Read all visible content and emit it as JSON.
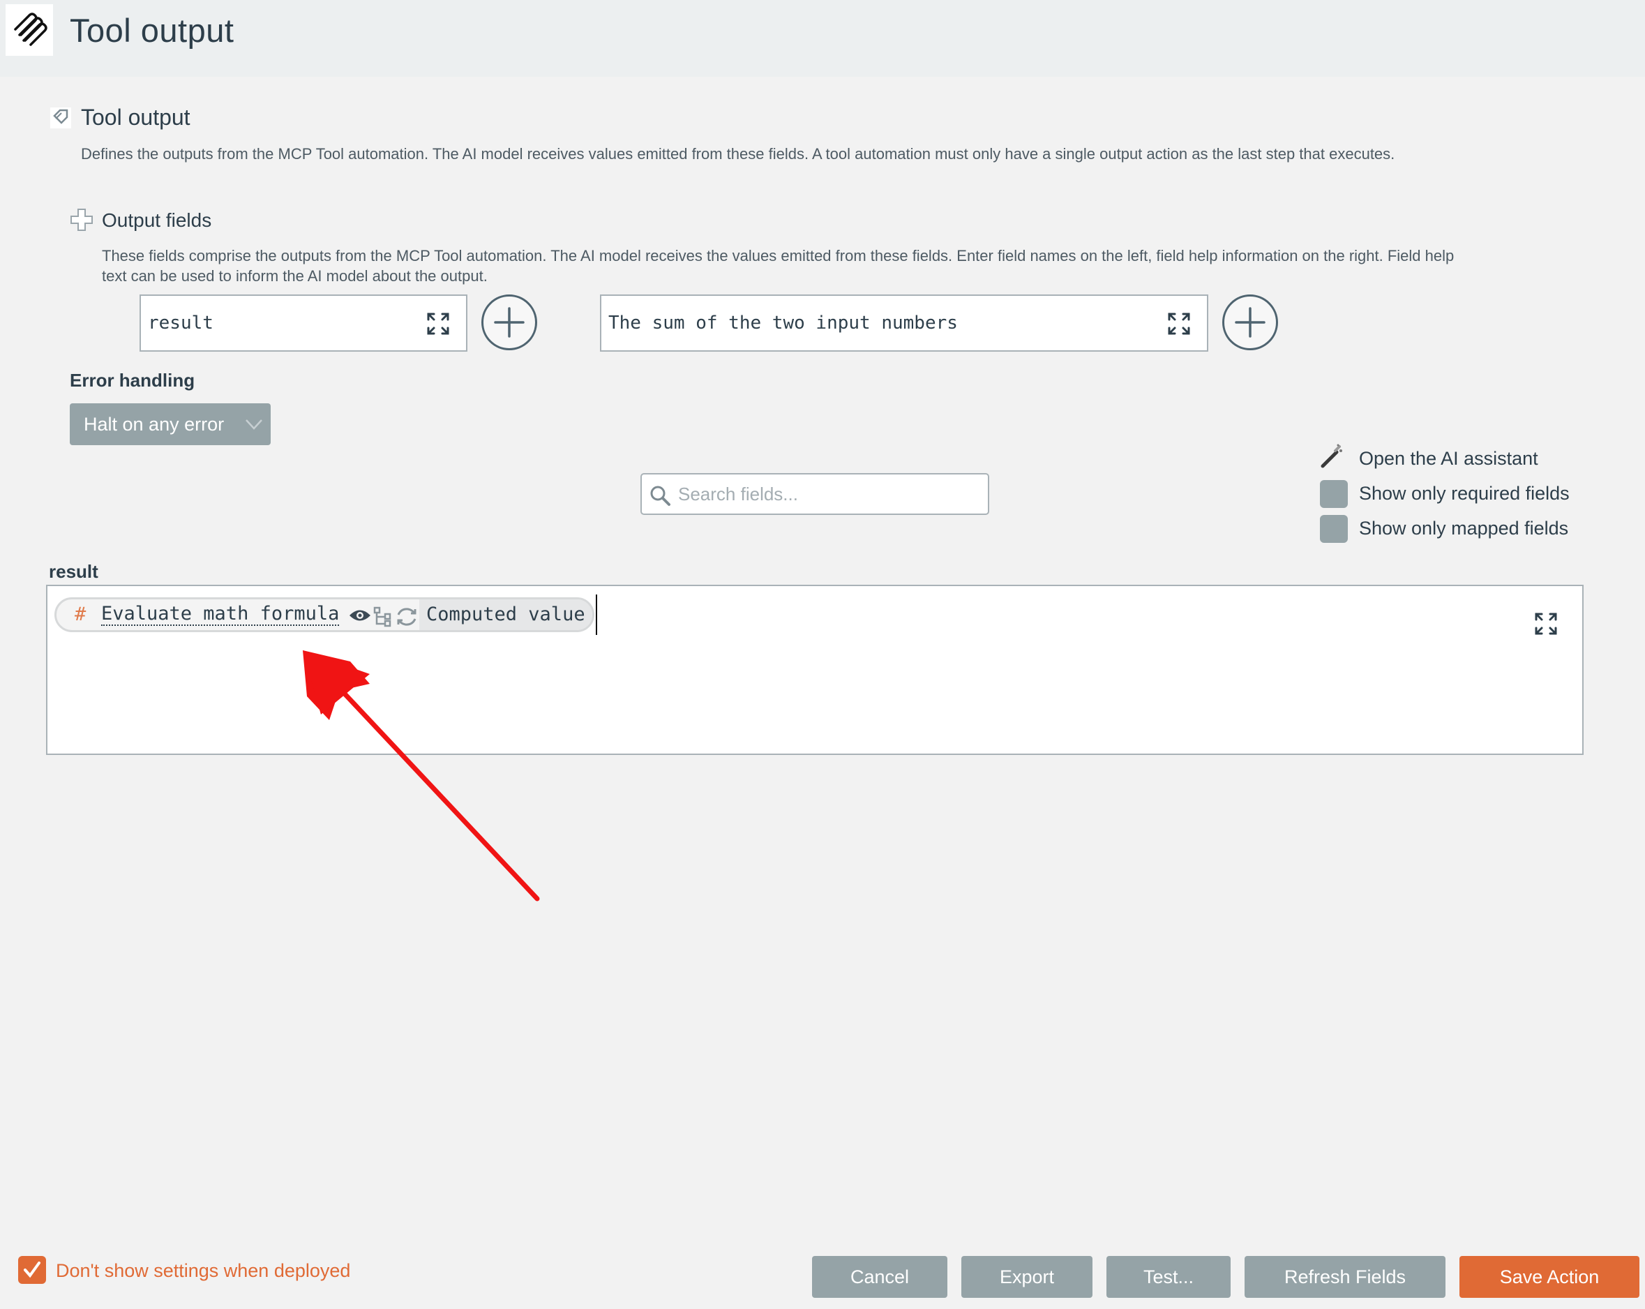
{
  "header": {
    "title": "Tool output",
    "icon": "paperclip-icon"
  },
  "section": {
    "title": "Tool output",
    "description": "Defines the outputs from the MCP Tool automation.  The AI model receives values emitted from these fields.  A tool automation must only have a single output action as the last step that executes."
  },
  "output_fields": {
    "title": "Output fields",
    "description": "These fields comprise the outputs from the MCP Tool automation. The AI model receives the values emitted from these fields. Enter field names on the left, field help information on the right. Field help text can be used to inform the AI model about the output.",
    "name_value": "result",
    "help_value": "The sum of the two input numbers"
  },
  "error_handling": {
    "label": "Error handling",
    "selected": "Halt on any error"
  },
  "search": {
    "placeholder": "Search fields..."
  },
  "options": {
    "ai_assistant": "Open the AI assistant",
    "required_only": "Show only required fields",
    "mapped_only": "Show only mapped fields"
  },
  "result": {
    "label": "result",
    "token_source": "Evaluate math formula",
    "token_value": "Computed value"
  },
  "footer": {
    "dont_show_label": "Don't show settings when deployed",
    "dont_show_checked": true,
    "buttons": {
      "cancel": "Cancel",
      "export": "Export",
      "test": "Test...",
      "refresh": "Refresh Fields",
      "save": "Save Action"
    }
  },
  "colors": {
    "accent": "#e06a35",
    "button_gray": "#95a3a7",
    "text": "#2d3e4a",
    "annotation_arrow": "#f01414"
  }
}
